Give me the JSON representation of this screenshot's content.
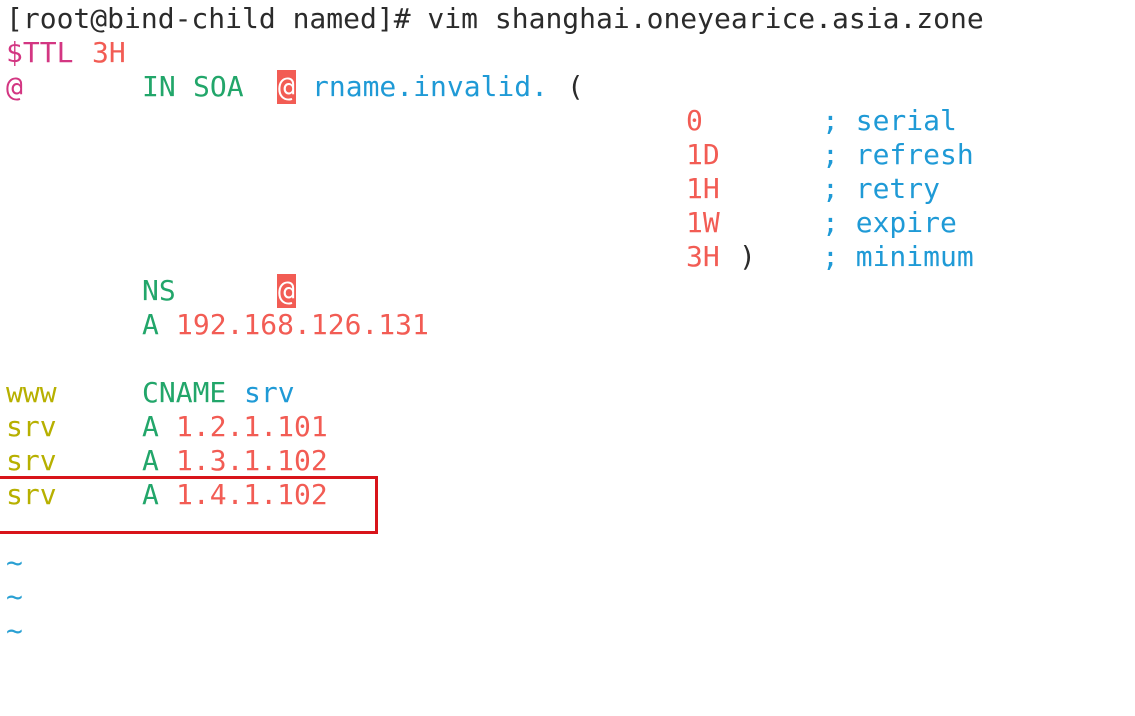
{
  "terminal": {
    "prompt": "[root@bind-child named]# vim shanghai.oneyearice.asia.zone",
    "ttl_directive": "$TTL",
    "ttl_value": "3H",
    "soa": {
      "origin": "@",
      "class": "IN",
      "type": "SOA",
      "mname": "@",
      "rname": "rname.invalid.",
      "open_paren": "(",
      "close_paren": ")",
      "fields": [
        {
          "value": "0",
          "comment": "; serial"
        },
        {
          "value": "1D",
          "comment": "; refresh"
        },
        {
          "value": "1H",
          "comment": "; retry"
        },
        {
          "value": "1W",
          "comment": "; expire"
        },
        {
          "value": "3H",
          "comment": "; minimum"
        }
      ]
    },
    "ns_record": {
      "type": "NS",
      "value": "@"
    },
    "a_record": {
      "type": "A",
      "value": "192.168.126.131"
    },
    "records": [
      {
        "name": "www",
        "type": "CNAME",
        "value": "srv"
      },
      {
        "name": "srv",
        "type": "A",
        "value": "1.2.1.101"
      },
      {
        "name": "srv",
        "type": "A",
        "value": "1.3.1.102"
      },
      {
        "name": "srv",
        "type": "A",
        "value": "1.4.1.102"
      }
    ],
    "tildes": [
      "~",
      "~",
      "~"
    ]
  },
  "colors": {
    "text": "#2b2b2b",
    "directive": "#d33682",
    "value": "#f25c54",
    "keyword": "#22a66a",
    "comment": "#1f9ad6",
    "name": "#b7b000",
    "highlight_box": "#d8141a"
  }
}
